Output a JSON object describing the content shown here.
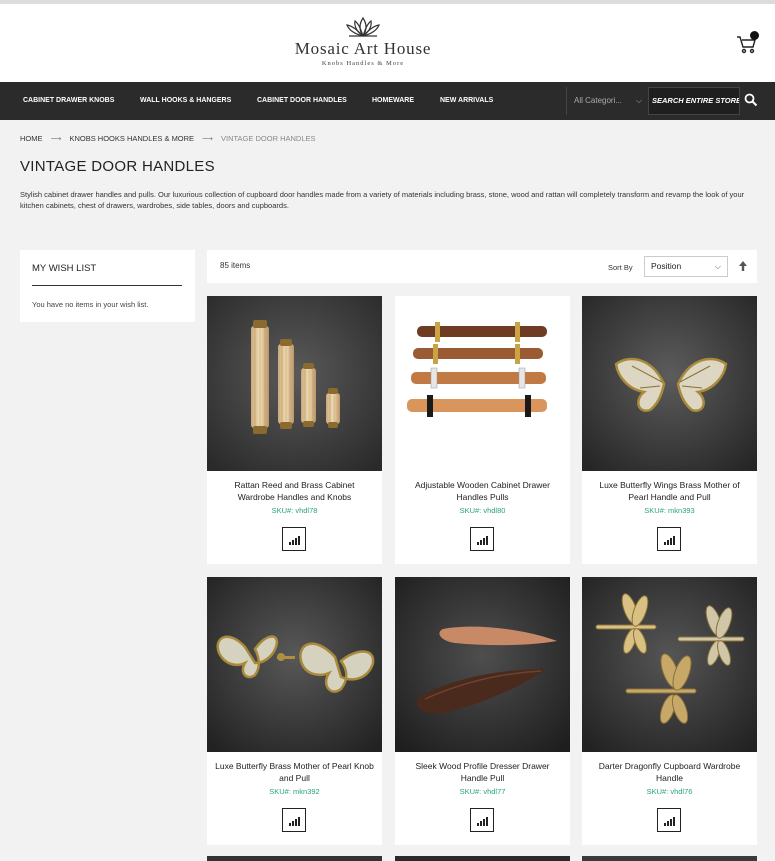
{
  "header": {
    "brand_name": "Mosaic Art House",
    "brand_tagline": "Knobs Handles & More",
    "cart_icon": "cart-icon"
  },
  "nav": {
    "items": [
      {
        "label": "CABINET DRAWER KNOBS"
      },
      {
        "label": "WALL HOOKS & HANGERS"
      },
      {
        "label": "CABINET DOOR HANDLES"
      },
      {
        "label": "HOMEWARE"
      },
      {
        "label": "NEW ARRIVALS"
      }
    ],
    "category_select": "All Categori...",
    "search_placeholder": "SEARCH ENTIRE STORE ..."
  },
  "breadcrumb": {
    "home": "HOME",
    "parent": "KNOBS HOOKS HANDLES & MORE",
    "current": "VINTAGE DOOR HANDLES"
  },
  "page": {
    "title": "VINTAGE DOOR HANDLES",
    "description": "Stylish cabinet drawer handles and pulls. Our luxurious collection of cupboard door handles made from a variety of materials including brass, stone, wood and rattan will completely transform and revamp the look of your kitchen cabinets, chest of drawers, wardrobes, side tables, doors and cupboards."
  },
  "wishlist": {
    "title": "MY WISH LIST",
    "empty_text": "You have no items in your wish list."
  },
  "toolbar": {
    "item_count": "85 items",
    "sort_label": "Sort By",
    "sort_value": "Position"
  },
  "products": [
    {
      "name": "Rattan Reed and Brass Cabinet Wardrobe Handles and Knobs",
      "sku": "SKU#: vhdl78"
    },
    {
      "name": "Adjustable Wooden Cabinet Drawer Handles Pulls",
      "sku": "SKU#: vhdl80"
    },
    {
      "name": "Luxe Butterfly Wings Brass Mother of Pearl Handle and Pull",
      "sku": "SKU#: mkn393"
    },
    {
      "name": "Luxe Butterfly Brass Mother of Pearl Knob and Pull",
      "sku": "SKU#: mkn392"
    },
    {
      "name": "Sleek Wood Profile Dresser Drawer Handle Pull",
      "sku": "SKU#: vhdl77"
    },
    {
      "name": "Darter Dragonfly Cupboard Wardrobe Handle",
      "sku": "SKU#: vhdl76"
    }
  ],
  "colors": {
    "nav_background": "#2b2b2b",
    "sku_green": "#2aa37a",
    "page_background": "#f2f2f2"
  }
}
